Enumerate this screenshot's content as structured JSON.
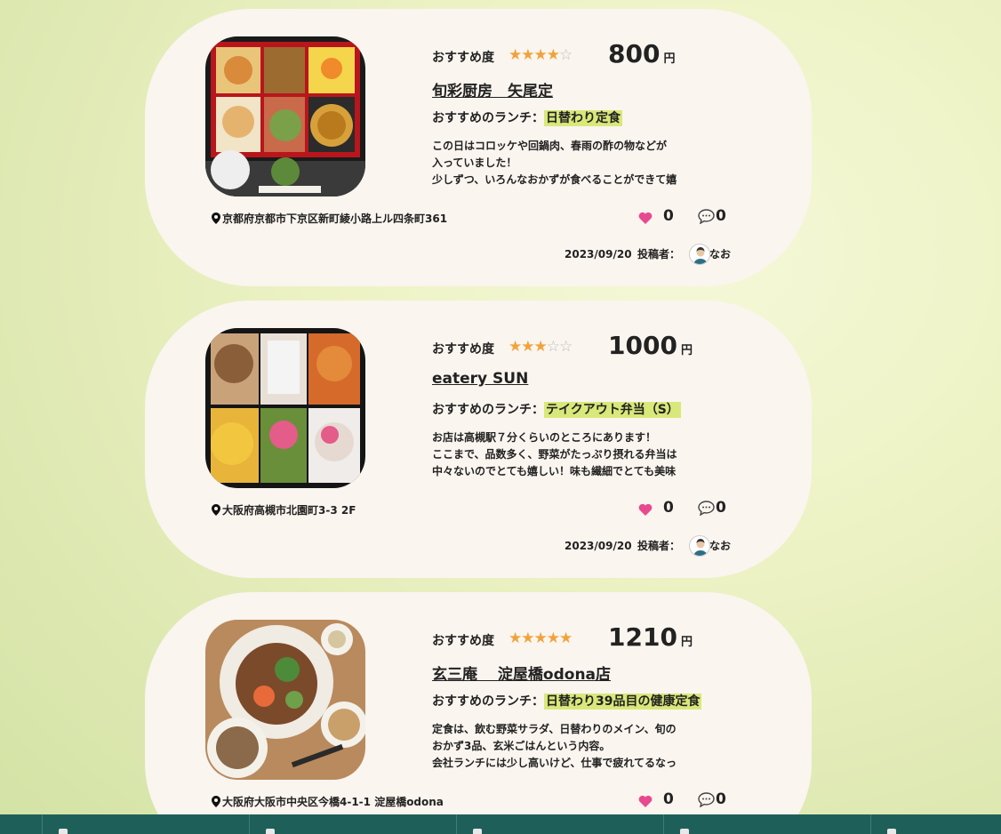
{
  "labels": {
    "rating": "おすすめ度",
    "lunch_prefix": "おすすめのランチ：",
    "poster_prefix": "投稿者：",
    "yen": "円"
  },
  "colors": {
    "card_bg": "#faf5ef",
    "star_on": "#f2a23a",
    "star_off": "#bdbdbd",
    "lunch_highlight": "#d9e87a",
    "heart": "#e84a8f",
    "footer": "#1f5f5a"
  },
  "posts": [
    {
      "stars": 4,
      "price": "800",
      "shop": "旬彩厨房　矢尾定",
      "lunch": "日替わり定食",
      "desc_lines": [
        "この日はコロッケや回鍋肉、春雨の酢の物などが",
        "入っていました！",
        "少しずつ、いろんなおかずが食べることができて嬉"
      ],
      "address": "京都府京都市下京区新町綾小路上ル四条町361",
      "likes": "0",
      "comments": "0",
      "date": "2023/09/20",
      "poster": "なお",
      "image_icon": "bento-box-photo"
    },
    {
      "stars": 3,
      "price": "1000",
      "shop": "eatery SUN",
      "lunch": "テイクアウト弁当（S）",
      "desc_lines": [
        "お店は高槻駅７分くらいのところにあります！",
        "ここまで、品数多く、野菜がたっぷり摂れる弁当は",
        "中々ないのでとても嬉しい！味も繊細でとても美味"
      ],
      "address": "大阪府高槻市北園町3-3 2F",
      "likes": "0",
      "comments": "0",
      "date": "2023/09/20",
      "poster": "なお",
      "image_icon": "takeout-bento-photo"
    },
    {
      "stars": 5,
      "price": "1210",
      "shop": "玄三庵　 淀屋橋odona店",
      "lunch": "日替わり39品目の健康定食",
      "desc_lines": [
        "定食は、飲む野菜サラダ、日替わりのメイン、旬の",
        "おかず3品、玄米ごはんという内容。",
        "会社ランチには少し高いけど、仕事で疲れてるなっ"
      ],
      "address": "大阪府大阪市中央区今橋4-1-1 淀屋橋odona",
      "likes": "0",
      "comments": "0",
      "date": "",
      "poster": "",
      "image_icon": "healthy-teishoku-photo"
    }
  ],
  "footer": {
    "items": [
      "home-nav",
      "search-nav",
      "post-nav",
      "ranking-nav",
      "mypage-nav"
    ]
  }
}
